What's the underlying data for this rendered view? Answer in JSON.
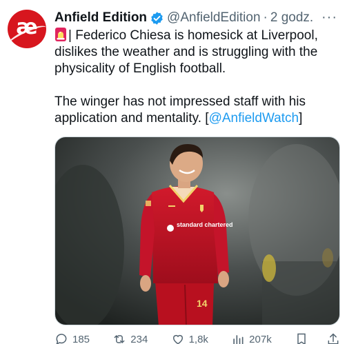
{
  "account": {
    "display_name": "Anfield Edition",
    "handle": "@AnfieldEdition",
    "separator": "·",
    "time": "2 godz.",
    "verified": true,
    "avatar_text": "æ",
    "avatar_color": "#d7161e"
  },
  "tweet": {
    "paragraph1": "| Federico Chiesa is homesick at Liverpool, dislikes the weather and is struggling with the physicality of English football.",
    "paragraph2_prefix": "The winger has not impressed staff with his application and mentality. [",
    "mention": "@AnfieldWatch",
    "paragraph2_suffix": "]",
    "leading_emoji_icon": "siren-icon"
  },
  "media": {
    "jersey_sponsor": "standard chartered",
    "shirt_number": "14"
  },
  "actions": {
    "replies": "185",
    "reposts": "234",
    "likes": "1,8k",
    "views": "207k"
  },
  "colors": {
    "accent": "#1d9bf0",
    "secondary_text": "#536471",
    "primary_text": "#0f1419",
    "jersey_red": "#c8102e"
  }
}
